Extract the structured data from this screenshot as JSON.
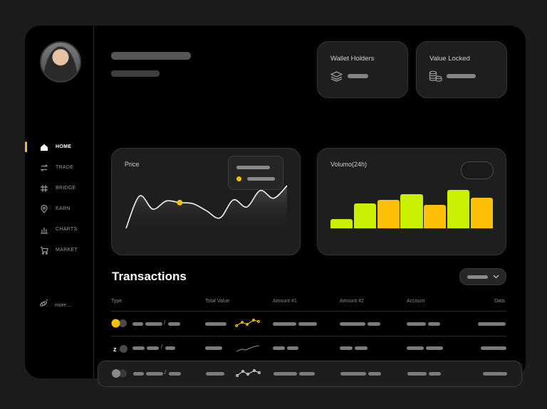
{
  "nav": {
    "items": [
      {
        "label": "HOME",
        "icon": "home-icon"
      },
      {
        "label": "TRADE",
        "icon": "swap-icon"
      },
      {
        "label": "BRIDGE",
        "icon": "bridge-icon"
      },
      {
        "label": "EARN",
        "icon": "location-pin-icon"
      },
      {
        "label": "CHARTS",
        "icon": "bar-chart-icon"
      },
      {
        "label": "MARKET",
        "icon": "cart-icon"
      }
    ],
    "active": "HOME",
    "more_label": "more ..."
  },
  "stats": {
    "wallet_holders_label": "Wallet Holders",
    "value_locked_label": "Value Locked"
  },
  "price_card": {
    "title": "Price"
  },
  "volume_card": {
    "title": "Volumo(24h)"
  },
  "chart_data": [
    {
      "type": "line",
      "title": "Price",
      "series": [
        {
          "values": [
            3,
            62,
            38,
            53,
            50,
            48,
            35,
            22,
            55,
            42,
            72,
            58,
            81
          ]
        }
      ],
      "highlight_index": 4,
      "accent": "#f5c000"
    },
    {
      "type": "bar",
      "title": "Volumo(24h)",
      "values": [
        12,
        33,
        38,
        45,
        31,
        51,
        41
      ],
      "colors": [
        "#c8f000",
        "#c8f000",
        "#ffc107",
        "#c8f000",
        "#ffc107",
        "#c8f000",
        "#ffc107"
      ]
    }
  ],
  "transactions": {
    "title": "Transactions",
    "columns": [
      "Type",
      "Total Value",
      "Amount #1",
      "Amount #2",
      "Account",
      "Data"
    ]
  },
  "colors": {
    "accent_yellow": "#f5c000",
    "accent_green": "#c8f000",
    "background": "#000000"
  }
}
